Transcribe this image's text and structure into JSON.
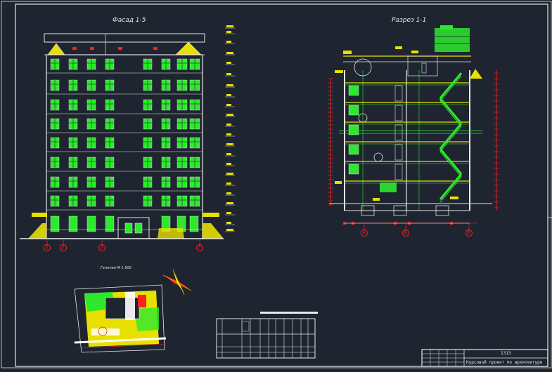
{
  "drawing": {
    "facade_title": "Фасад 1-5",
    "section_title": "Разрез 1-1",
    "siteplan_title": "Генплан М 1:500",
    "axes_facade": [
      "1",
      "2",
      "3",
      "4",
      "5"
    ],
    "axes_section": [
      "А",
      "Б",
      "В"
    ],
    "title_block": {
      "code": "1313",
      "name": "Курсовой проект по архитектуре"
    }
  },
  "colors": {
    "background": "#1e2530",
    "line_white": "#e8e8e8",
    "window_green": "#2ee82e",
    "accent_yellow": "#f2f20f",
    "axis_red": "#ff2020"
  }
}
